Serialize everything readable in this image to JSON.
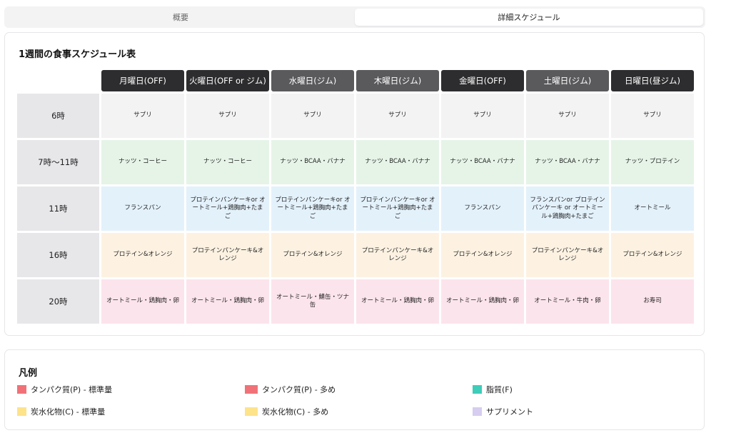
{
  "tabs": [
    {
      "label": "概要",
      "active": false
    },
    {
      "label": "詳細スケジュール",
      "active": true
    }
  ],
  "schedule": {
    "title": "1週間の食事スケジュール表",
    "days": [
      {
        "label": "月曜日(OFF)"
      },
      {
        "label": "火曜日(OFF or ジム)"
      },
      {
        "label": "水曜日(ジム)"
      },
      {
        "label": "木曜日(ジム)"
      },
      {
        "label": "金曜日(OFF)"
      },
      {
        "label": "土曜日(ジム)"
      },
      {
        "label": "日曜日(昼ジム)"
      }
    ],
    "rows": [
      {
        "time": "6時",
        "cells": [
          "サプリ",
          "サプリ",
          "サプリ",
          "サプリ",
          "サプリ",
          "サプリ",
          "サプリ"
        ]
      },
      {
        "time": "7時〜11時",
        "cells": [
          "ナッツ・コーヒー",
          "ナッツ・コーヒー",
          "ナッツ・BCAA・バナナ",
          "ナッツ・BCAA・バナナ",
          "ナッツ・BCAA・バナナ",
          "ナッツ・BCAA・バナナ",
          "ナッツ・プロテイン"
        ]
      },
      {
        "time": "11時",
        "cells": [
          "フランスパン",
          "プロテインパンケーキor オートミール+鶏胸肉+たまご",
          "プロテインパンケーキor オートミール+鶏胸肉+たまご",
          "プロテインパンケーキor オートミール+鶏胸肉+たまご",
          "フランスパン",
          "フランスパンor プロテインパンケーキ or オートミール+鶏胸肉+たまご",
          "オートミール"
        ]
      },
      {
        "time": "16時",
        "cells": [
          "プロテイン&オレンジ",
          "プロテインパンケーキ&オレンジ",
          "プロテイン&オレンジ",
          "プロテインパンケーキ&オレンジ",
          "プロテイン&オレンジ",
          "プロテインパンケーキ&オレンジ",
          "プロテイン&オレンジ"
        ]
      },
      {
        "time": "20時",
        "cells": [
          "オートミール・鶏胸肉・卵",
          "オートミール・鶏胸肉・卵",
          "オートミール・鯖缶・ツナ缶",
          "オートミール・鶏胸肉・卵",
          "オートミール・鶏胸肉・卵",
          "オートミール・牛肉・卵",
          "お寿司"
        ]
      }
    ],
    "colors": {
      "header_dark": "#2d2d2f",
      "header_gray": "#5a5a5d",
      "row_colors": [
        "#f3f3f3",
        "#e6f4e8",
        "#e3f1fb",
        "#fdf2e2",
        "#fce4ec"
      ]
    }
  },
  "legend": {
    "title": "凡例",
    "items": [
      {
        "label": "タンパク質(P) - 標準量",
        "color": "#f07278"
      },
      {
        "label": "タンパク質(P) - 多め",
        "color": "#f07278"
      },
      {
        "label": "脂質(F)",
        "color": "#3ecdb9"
      },
      {
        "label": "炭水化物(C) - 標準量",
        "color": "#fde38a"
      },
      {
        "label": "炭水化物(C) - 多め",
        "color": "#fde38a"
      },
      {
        "label": "サプリメント",
        "color": "#d6cdf0"
      }
    ]
  }
}
